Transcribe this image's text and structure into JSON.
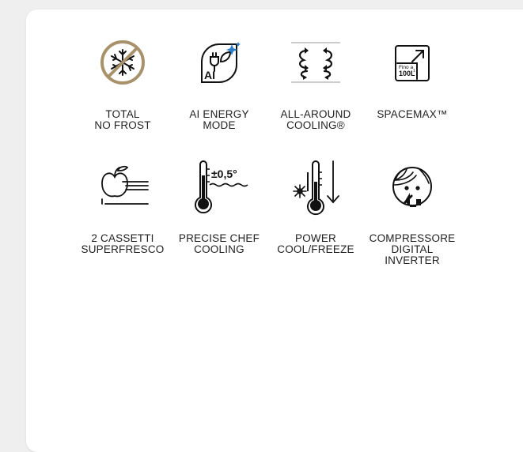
{
  "features": [
    {
      "icon": "no-frost-icon",
      "label": "TOTAL\nNO FROST"
    },
    {
      "icon": "ai-energy-icon",
      "label": "AI ENERGY\nMODE",
      "icon_text": "AI"
    },
    {
      "icon": "all-around-cooling-icon",
      "label": "ALL-AROUND\nCOOLING®"
    },
    {
      "icon": "spacemax-icon",
      "label": "SPACEMAX™",
      "icon_text_1": "Fino a",
      "icon_text_2": "100L",
      "icon_text_sup": "1"
    },
    {
      "icon": "crisper-drawers-icon",
      "label": "2 CASSETTI\nSUPERFRESCO"
    },
    {
      "icon": "precise-chef-icon",
      "label": "PRECISE CHEF\nCOOLING",
      "icon_text": "±0,5°"
    },
    {
      "icon": "power-cool-freeze-icon",
      "label": "POWER\nCOOL/FREEZE"
    },
    {
      "icon": "digital-inverter-icon",
      "label": "COMPRESSORE\nDIGITAL\nINVERTER"
    }
  ],
  "colors": {
    "gold": "#a8926b",
    "ink": "#111111",
    "accent_blue": "#2f7ec8",
    "background": "#efefef",
    "card": "#ffffff"
  }
}
